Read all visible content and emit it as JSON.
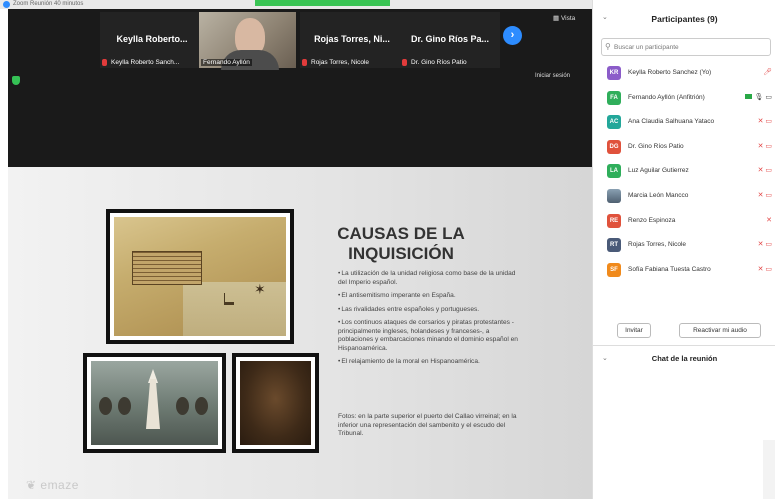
{
  "window": {
    "title": "Zoom Reunión 40 minutos"
  },
  "toolbar": {
    "view_label": "Vista",
    "signin_label": "Iniciar sesión"
  },
  "tiles": [
    {
      "name": "Keylla Roberto...",
      "label": "Keylla Roberto Sanch...",
      "muted": true
    },
    {
      "name": "",
      "label": "Fernando Ayllón",
      "muted": false,
      "video": true
    },
    {
      "name": "Rojas Torres, Ni...",
      "label": "Rojas Torres, Nicole",
      "muted": true
    },
    {
      "name": "Dr. Gino Ríos Pa...",
      "label": "Dr. Gino Ríos Patio",
      "muted": true
    }
  ],
  "slide": {
    "title": "CAUSAS DE LA INQUISICIÓN",
    "bullets": [
      "La utilización de la unidad religiosa como base de la unidad del Imperio español.",
      "El antisemitismo imperante en España.",
      "Las rivalidades entre españoles y portugueses.",
      "Los continuos ataques de corsarios y piratas protestantes -principalmente ingleses, holandeses y franceses-, a poblaciones y embarcaciones minando el dominio español en Hispanoamérica.",
      "El relajamiento de la moral en Hispanoamérica."
    ],
    "caption": "Fotos: en la parte superior el puerto del Callao virreinal; en la inferior una representación del sambenito y el escudo del Tribunal.",
    "logo": "emaze"
  },
  "participants": {
    "title": "Participantes (9)",
    "search_placeholder": "Buscar un participante",
    "list": [
      {
        "initials": "KR",
        "name": "Keylla Roberto Sanchez (Yo)",
        "color": "#8b5cc9",
        "status": "mic"
      },
      {
        "initials": "FA",
        "name": "Fernando Ayllón (Anfitrión)",
        "color": "#2fae5b",
        "status": "host"
      },
      {
        "initials": "AC",
        "name": "Ana Claudia Salhuana Yataco",
        "color": "#23a79a",
        "status": "mic-video"
      },
      {
        "initials": "DG",
        "name": "Dr. Gino Ríos Patio",
        "color": "#e0523c",
        "status": "mic-video"
      },
      {
        "initials": "LA",
        "name": "Luz Aguilar Gutierrez",
        "color": "#2fae5b",
        "status": "mic-video"
      },
      {
        "initials": "",
        "name": "Marcia León Mancco",
        "color": "#5a6d7d",
        "status": "mic-video",
        "photo": true
      },
      {
        "initials": "RE",
        "name": "Renzo Espinoza",
        "color": "#e0523c",
        "status": "mic"
      },
      {
        "initials": "RT",
        "name": "Rojas Torres, Nicole",
        "color": "#4a5a78",
        "status": "mic-video"
      },
      {
        "initials": "SF",
        "name": "Sofía Fabiana Tuesta Castro",
        "color": "#f08a1c",
        "status": "mic-video"
      }
    ],
    "invite_label": "Invitar",
    "unmute_label": "Reactivar mi audio"
  },
  "chat": {
    "title": "Chat de la reunión"
  }
}
